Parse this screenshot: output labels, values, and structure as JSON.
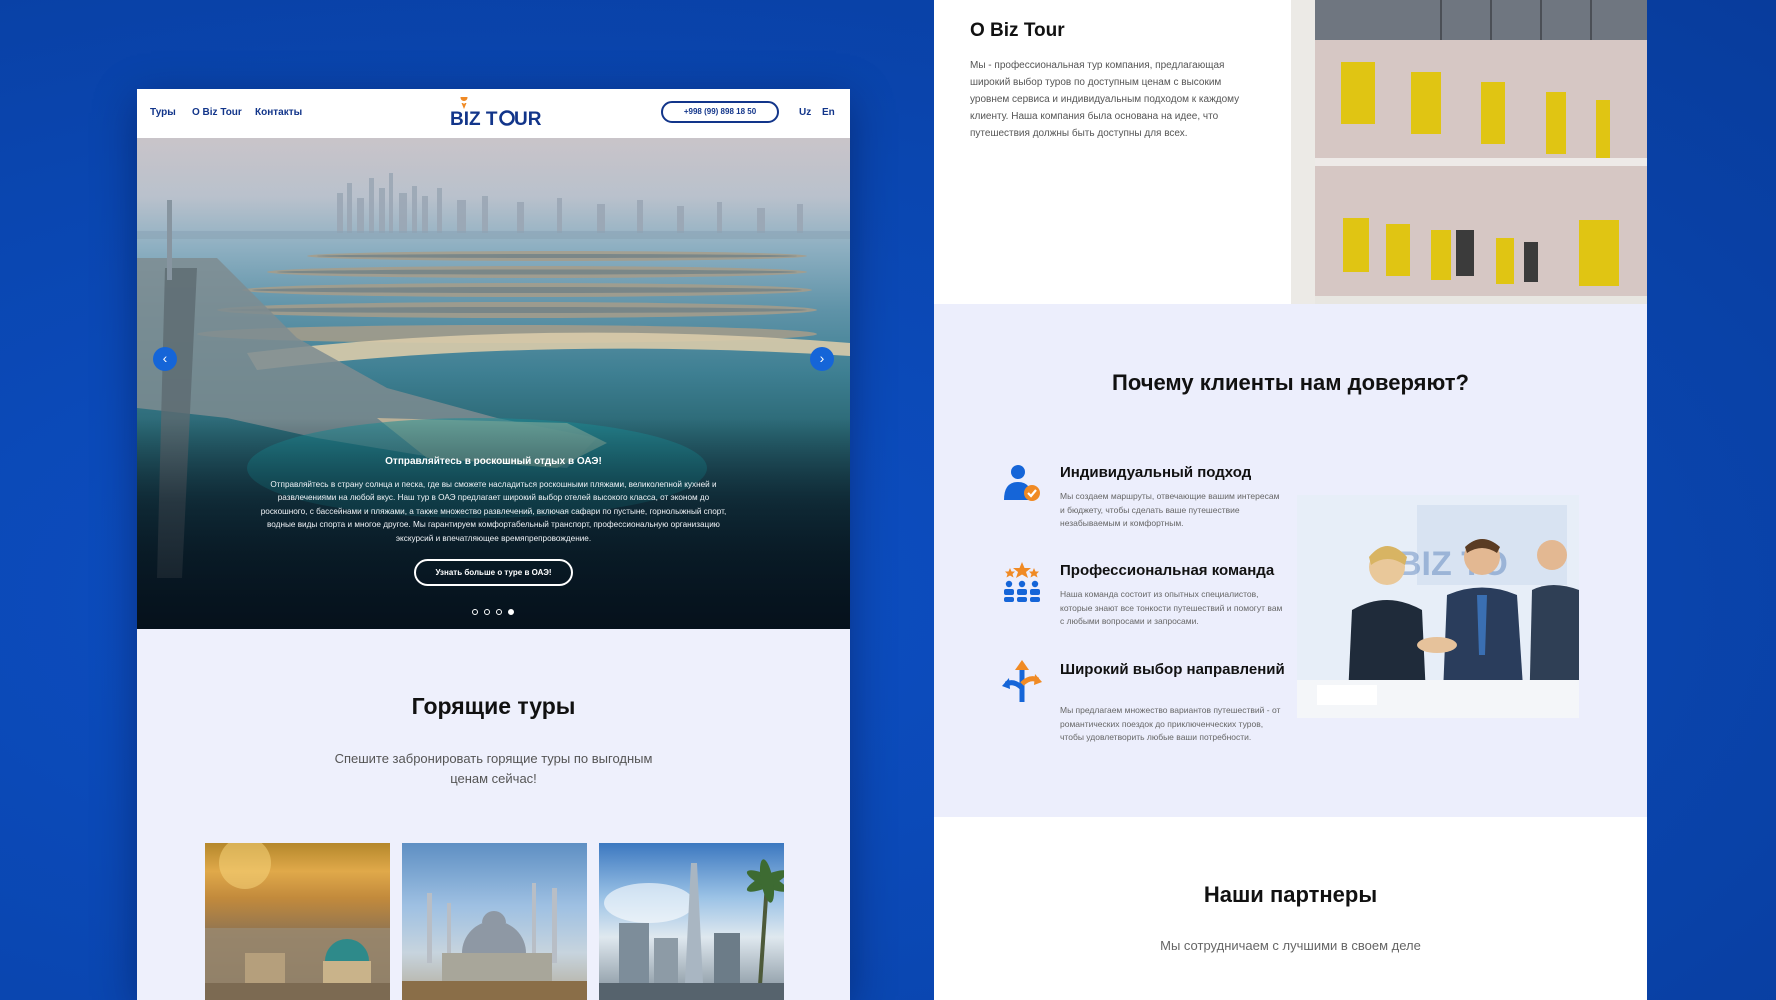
{
  "nav": {
    "links": [
      "Туры",
      "О Biz Tour",
      "Контакты"
    ],
    "logo": "BIZ TOUR",
    "phone": "+998 (99) 898 18 50",
    "langs": [
      "Uz",
      "En"
    ]
  },
  "hero": {
    "title": "Отправляйтесь в роскошный отдых в ОАЭ!",
    "text": "Отправляйтесь в страну солнца и песка, где вы сможете насладиться роскошными пляжами, великолепной кухней и развлечениями на любой вкус. Наш тур в ОАЭ предлагает широкий выбор отелей высокого класса, от эконом до роскошного, с бассейнами и пляжами, а также множество развлечений, включая сафари по пустыне, горнолыжный спорт, водные виды спорта и многое другое. Мы гарантируем комфортабельный транспорт, профессиональную организацию экскурсий и впечатляющее времяпрепровождение.",
    "button": "Узнать больше о туре в ОАЭ!",
    "prev_icon": "‹",
    "next_icon": "›",
    "slides": 4,
    "active_slide": 4
  },
  "hot_tours": {
    "title": "Горящие туры",
    "subtitle": "Спешите забронировать горящие туры по выгодным ценам сейчас!"
  },
  "about": {
    "title": "О Biz Tour",
    "text": "Мы - профессиональная тур компания, предлагающая широкий выбор туров по доступным ценам с высоким уровнем сервиса и индивидуальным подходом к каждому клиенту. Наша компания была основана на идее, что путешествия должны быть доступны для всех."
  },
  "why": {
    "title": "Почему клиенты нам доверяют?",
    "features": [
      {
        "title": "Индивидуальный подход",
        "text": "Мы создаем маршруты, отвечающие вашим интересам и бюджету, чтобы сделать ваше путешествие незабываемым и комфортным."
      },
      {
        "title": "Профессиональная команда",
        "text": "Наша команда состоит из опытных специалистов, которые знают все тонкости путешествий и помогут вам с любыми вопросами и запросами."
      },
      {
        "title": "Широкий выбор направлений",
        "text": "Мы предлагаем множество вариантов путешествий - от романтических поездок до приключенческих туров, чтобы удовлетворить любые ваши потребности."
      }
    ]
  },
  "partners": {
    "title": "Наши партнеры",
    "subtitle": "Мы сотрудничаем с лучшими в своем деле"
  },
  "colors": {
    "background": "#0a47b3",
    "brand": "#12358a",
    "accent_orange": "#f08a24",
    "accent_blue": "#1565d8",
    "section_bg": "#eceefc"
  }
}
